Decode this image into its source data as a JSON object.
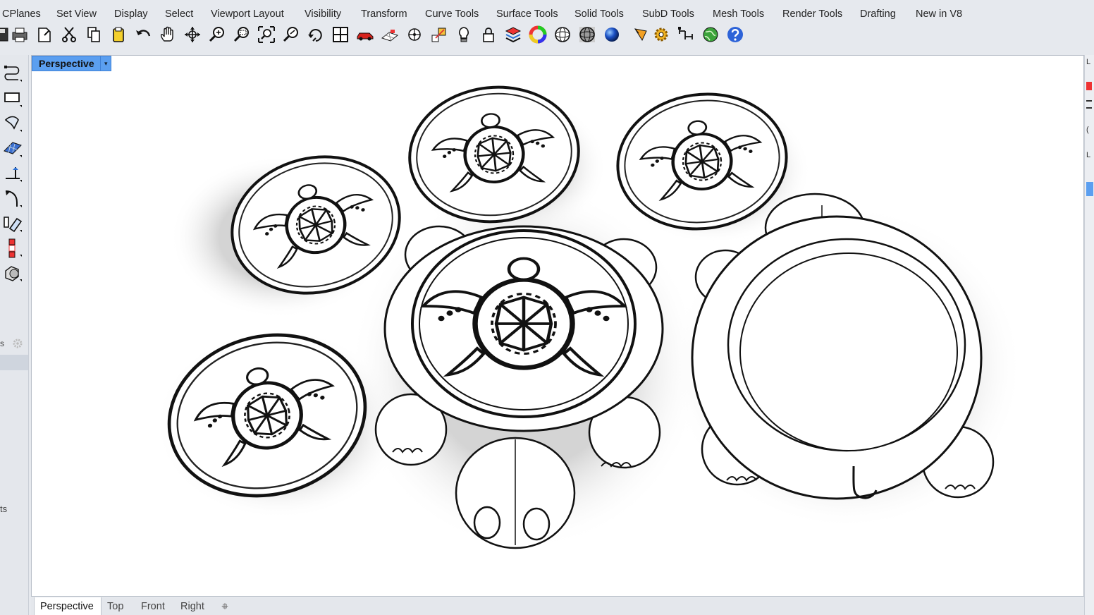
{
  "menu": [
    "CPlanes",
    "Set View",
    "Display",
    "Select",
    "Viewport Layout",
    "Visibility",
    "Transform",
    "Curve Tools",
    "Surface Tools",
    "Solid Tools",
    "SubD Tools",
    "Mesh Tools",
    "Render Tools",
    "Drafting",
    "New in V8"
  ],
  "toolbar_icons": [
    "save-icon",
    "print-icon",
    "import-icon",
    "cut-icon",
    "copy-icon",
    "paste-icon",
    "undo-icon",
    "pan-hand-icon",
    "rotate-view-icon",
    "zoom-dynamic-icon",
    "zoom-window-icon",
    "zoom-extents-icon",
    "zoom-selected-icon",
    "rotate-icon",
    "four-viewports-icon",
    "car-icon",
    "grid-snap-icon",
    "osnap-icon",
    "gumball-icon",
    "light-icon",
    "lock-icon",
    "layers-icon",
    "color-wheel-icon",
    "wireframe-sphere-icon",
    "shaded-sphere-icon",
    "render-sphere-icon",
    "pen-icon",
    "settings-gear-icon",
    "dimension-icon",
    "globe-icon",
    "help-icon"
  ],
  "left_tools": [
    "curve-tool-icon",
    "rectangle-tool-icon",
    "surface-tool-icon",
    "plane-surface-icon",
    "dimension-tool-icon",
    "fillet-tool-icon",
    "transform-tool-icon",
    "array-tool-icon",
    "solid-tool-icon"
  ],
  "left_panel": {
    "label_top": "s",
    "label_bottom": "ts"
  },
  "viewport": {
    "active_name": "Perspective",
    "menu_arrow": "▾"
  },
  "right_panel_letters": [
    "L",
    "(",
    "L"
  ],
  "bottom_tabs": [
    {
      "label": "Perspective",
      "active": true
    },
    {
      "label": "Top",
      "active": false
    },
    {
      "label": "Front",
      "active": false
    },
    {
      "label": "Right",
      "active": false
    }
  ],
  "add_tab_icon": "add-viewport-icon",
  "colors": {
    "accent": "#5b9ff0",
    "viewport_bg": "#ffffff",
    "chrome": "#e6e9ee"
  }
}
